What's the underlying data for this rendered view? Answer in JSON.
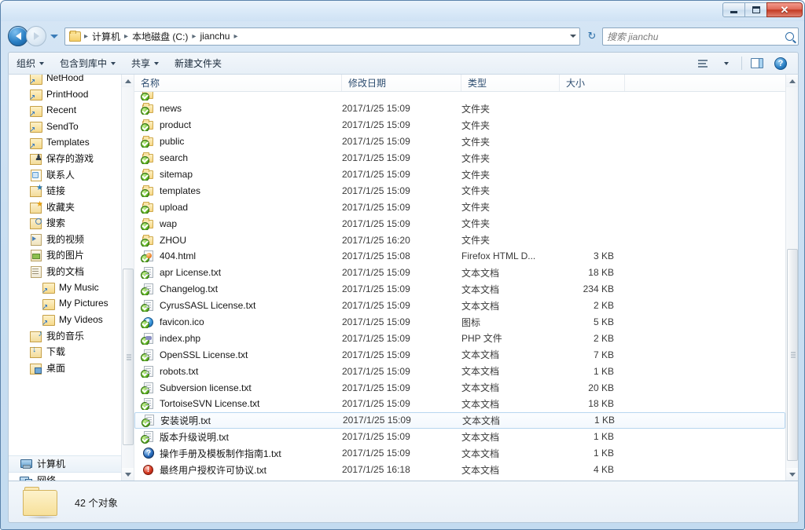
{
  "window": {
    "titlebar": {
      "minimize_label": "–",
      "maximize_label": "□",
      "close_label": "✕"
    }
  },
  "address": {
    "back_tooltip": "后退",
    "forward_tooltip": "前进",
    "breadcrumbs": [
      "计算机",
      "本地磁盘 (C:)",
      "jianchu"
    ],
    "separator": "▸",
    "refresh_label": "↻"
  },
  "search": {
    "placeholder": "搜索 jianchu",
    "icon": "search-icon"
  },
  "toolbar": {
    "items": [
      {
        "label": "组织",
        "has_caret": true
      },
      {
        "label": "包含到库中",
        "has_caret": true
      },
      {
        "label": "共享",
        "has_caret": true
      },
      {
        "label": "新建文件夹",
        "has_caret": false
      }
    ],
    "view_icon": "view-list-icon",
    "preview_pane_icon": "preview-pane-icon",
    "help_icon": "help-icon",
    "help_label": "?"
  },
  "navpane": {
    "items": [
      {
        "label": "NetHood",
        "icon": "shortcut",
        "indent": true
      },
      {
        "label": "PrintHood",
        "icon": "shortcut",
        "indent": true
      },
      {
        "label": "Recent",
        "icon": "shortcut",
        "indent": true
      },
      {
        "label": "SendTo",
        "icon": "shortcut",
        "indent": true
      },
      {
        "label": "Templates",
        "icon": "shortcut",
        "indent": true
      },
      {
        "label": "保存的游戏",
        "icon": "games",
        "indent": true
      },
      {
        "label": "联系人",
        "icon": "contacts",
        "indent": true
      },
      {
        "label": "链接",
        "icon": "links",
        "indent": true
      },
      {
        "label": "收藏夹",
        "icon": "fav",
        "indent": true
      },
      {
        "label": "搜索",
        "icon": "search",
        "indent": true
      },
      {
        "label": "我的视频",
        "icon": "video",
        "indent": true
      },
      {
        "label": "我的图片",
        "icon": "pics",
        "indent": true
      },
      {
        "label": "我的文档",
        "icon": "docs",
        "indent": true
      },
      {
        "label": "My Music",
        "icon": "shortcut",
        "deep": true
      },
      {
        "label": "My Pictures",
        "icon": "shortcut",
        "deep": true
      },
      {
        "label": "My Videos",
        "icon": "shortcut",
        "deep": true
      },
      {
        "label": "我的音乐",
        "icon": "music",
        "indent": true
      },
      {
        "label": "下载",
        "icon": "down",
        "indent": true
      },
      {
        "label": "桌面",
        "icon": "desk",
        "indent": true
      }
    ],
    "bottom_items": [
      {
        "label": "计算机",
        "icon": "computer",
        "selected": true
      },
      {
        "label": "网络",
        "icon": "network",
        "selected": false
      }
    ]
  },
  "filelist": {
    "columns": [
      {
        "key": "name",
        "label": "名称"
      },
      {
        "key": "date",
        "label": "修改日期"
      },
      {
        "key": "type",
        "label": "类型"
      },
      {
        "key": "size",
        "label": "大小"
      }
    ],
    "rows": [
      {
        "name": "news",
        "date": "2017/1/25 15:09",
        "type": "文件夹",
        "size": "",
        "icon": "folder",
        "selected": false
      },
      {
        "name": "product",
        "date": "2017/1/25 15:09",
        "type": "文件夹",
        "size": "",
        "icon": "folder",
        "selected": false
      },
      {
        "name": "public",
        "date": "2017/1/25 15:09",
        "type": "文件夹",
        "size": "",
        "icon": "folder",
        "selected": false
      },
      {
        "name": "search",
        "date": "2017/1/25 15:09",
        "type": "文件夹",
        "size": "",
        "icon": "folder",
        "selected": false
      },
      {
        "name": "sitemap",
        "date": "2017/1/25 15:09",
        "type": "文件夹",
        "size": "",
        "icon": "folder",
        "selected": false
      },
      {
        "name": "templates",
        "date": "2017/1/25 15:09",
        "type": "文件夹",
        "size": "",
        "icon": "folder",
        "selected": false
      },
      {
        "name": "upload",
        "date": "2017/1/25 15:09",
        "type": "文件夹",
        "size": "",
        "icon": "folder",
        "selected": false
      },
      {
        "name": "wap",
        "date": "2017/1/25 15:09",
        "type": "文件夹",
        "size": "",
        "icon": "folder",
        "selected": false
      },
      {
        "name": "ZHOU",
        "date": "2017/1/25 16:20",
        "type": "文件夹",
        "size": "",
        "icon": "folder",
        "selected": false
      },
      {
        "name": "404.html",
        "date": "2017/1/25 15:08",
        "type": "Firefox HTML D...",
        "size": "3 KB",
        "icon": "html",
        "selected": false
      },
      {
        "name": "apr License.txt",
        "date": "2017/1/25 15:09",
        "type": "文本文档",
        "size": "18 KB",
        "icon": "doc",
        "selected": false
      },
      {
        "name": "Changelog.txt",
        "date": "2017/1/25 15:09",
        "type": "文本文档",
        "size": "234 KB",
        "icon": "doc",
        "selected": false
      },
      {
        "name": "CyrusSASL License.txt",
        "date": "2017/1/25 15:09",
        "type": "文本文档",
        "size": "2 KB",
        "icon": "doc",
        "selected": false
      },
      {
        "name": "favicon.ico",
        "date": "2017/1/25 15:09",
        "type": "图标",
        "size": "5 KB",
        "icon": "ico",
        "selected": false
      },
      {
        "name": "index.php",
        "date": "2017/1/25 15:09",
        "type": "PHP 文件",
        "size": "2 KB",
        "icon": "php",
        "selected": false
      },
      {
        "name": "OpenSSL License.txt",
        "date": "2017/1/25 15:09",
        "type": "文本文档",
        "size": "7 KB",
        "icon": "doc",
        "selected": false
      },
      {
        "name": "robots.txt",
        "date": "2017/1/25 15:09",
        "type": "文本文档",
        "size": "1 KB",
        "icon": "doc",
        "selected": false
      },
      {
        "name": "Subversion license.txt",
        "date": "2017/1/25 15:09",
        "type": "文本文档",
        "size": "20 KB",
        "icon": "doc",
        "selected": false
      },
      {
        "name": "TortoiseSVN License.txt",
        "date": "2017/1/25 15:09",
        "type": "文本文档",
        "size": "18 KB",
        "icon": "doc",
        "selected": false
      },
      {
        "name": "安装说明.txt",
        "date": "2017/1/25 15:09",
        "type": "文本文档",
        "size": "1 KB",
        "icon": "doc",
        "selected": true
      },
      {
        "name": "版本升级说明.txt",
        "date": "2017/1/25 15:09",
        "type": "文本文档",
        "size": "1 KB",
        "icon": "doc",
        "selected": false
      },
      {
        "name": "操作手册及模板制作指南1.txt",
        "date": "2017/1/25 15:09",
        "type": "文本文档",
        "size": "1 KB",
        "icon": "help",
        "selected": false
      },
      {
        "name": "最终用户授权许可协议.txt",
        "date": "2017/1/25 16:18",
        "type": "文本文档",
        "size": "4 KB",
        "icon": "warn",
        "selected": false
      }
    ]
  },
  "statusbar": {
    "text": "42 个对象",
    "icon": "folder-icon"
  },
  "colors": {
    "accent": "#2a7fc4",
    "frame": "#cadff2",
    "close_red": "#c33a23",
    "selection": "#b8d6ef",
    "svn_green": "#6cbf2e"
  }
}
